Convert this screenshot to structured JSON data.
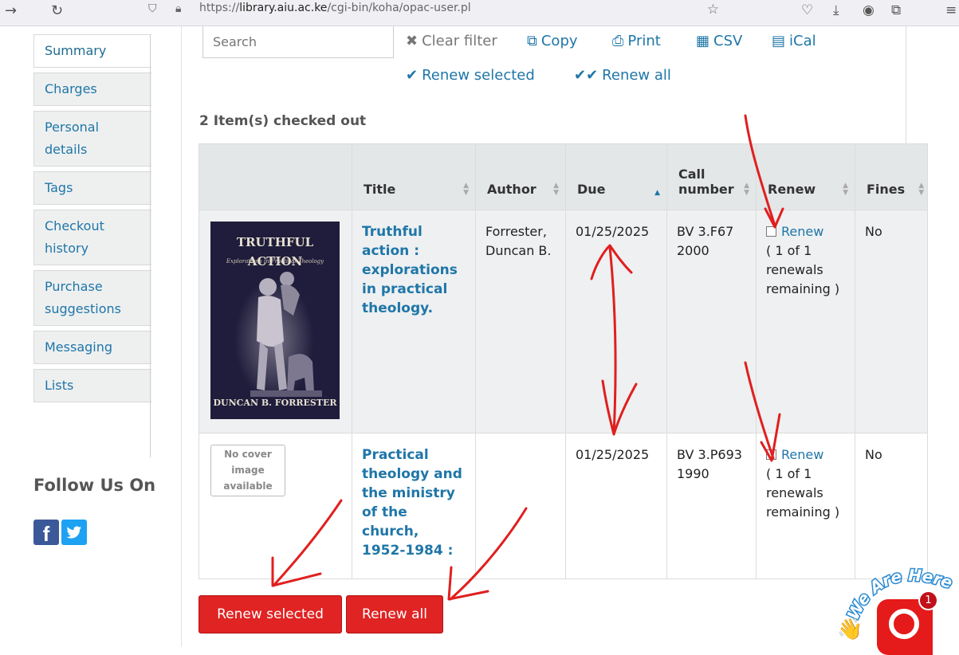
{
  "browser": {
    "url_domain": "library.aiu.ac.ke",
    "url_prefix": "https://",
    "url_path": "/cgi-bin/koha/opac-user.pl"
  },
  "sidebar": {
    "items": [
      {
        "label": "Summary",
        "active": true
      },
      {
        "label": "Charges"
      },
      {
        "label": "Personal\ndetails"
      },
      {
        "label": "Tags"
      },
      {
        "label": "Checkout\nhistory"
      },
      {
        "label": "Purchase\nsuggestions"
      },
      {
        "label": "Messaging"
      },
      {
        "label": "Lists"
      }
    ],
    "follow_title": "Follow Us On",
    "social": {
      "facebook": "f",
      "twitter": "t"
    }
  },
  "toolbar": {
    "search_placeholder": "Search",
    "clear_filter": "Clear filter",
    "copy": "Copy",
    "print": "Print",
    "csv": "CSV",
    "ical": "iCal",
    "renew_selected": "Renew selected",
    "renew_all": "Renew all"
  },
  "summary": {
    "checked_out": "2 Item(s) checked out"
  },
  "table": {
    "headers": {
      "title": "Title",
      "author": "Author",
      "due": "Due",
      "call_number": "Call number",
      "renew": "Renew",
      "fines": "Fines"
    },
    "rows": [
      {
        "cover": {
          "title": "TRUTHFUL ACTION",
          "subtitle": "Explorations in Practical Theology",
          "author": "DUNCAN B. FORRESTER"
        },
        "title": "Truthful action : explorations in practical theology.",
        "author": "Forrester, Duncan B.",
        "due": "01/25/2025",
        "call_number": "BV 3.F67 2000",
        "renew_label": "Renew",
        "renew_remaining": "( 1 of 1 renewals remaining )",
        "fines": "No"
      },
      {
        "cover": {
          "no_cover": "No cover image available"
        },
        "title": "Practical theology and the ministry of the church, 1952-1984 :",
        "author": "",
        "due": "01/25/2025",
        "call_number": "BV 3.P693 1990",
        "renew_label": "Renew",
        "renew_remaining": "( 1 of 1 renewals remaining )",
        "fines": "No"
      }
    ]
  },
  "buttons": {
    "renew_selected": "Renew selected",
    "renew_all": "Renew all"
  },
  "chat": {
    "badge": "1",
    "banner": "We Are Here!"
  },
  "colors": {
    "link": "#1f76a8",
    "button_red": "#e02323",
    "annotation_red": "#e01f1f",
    "header_bg": "#e4e7e8"
  }
}
